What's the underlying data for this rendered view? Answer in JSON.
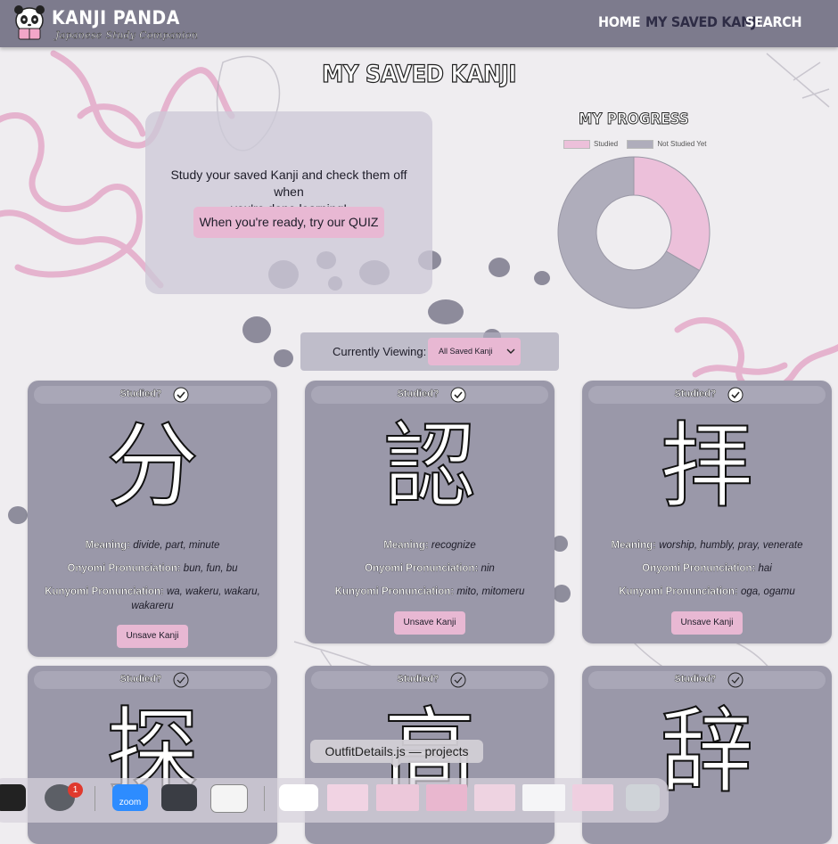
{
  "nav": {
    "brand": "KANJI PANDA",
    "tagline": "Japanese Study Companion",
    "links": [
      {
        "label": "HOME",
        "active": false
      },
      {
        "label": "MY SAVED KANJI",
        "active": true
      },
      {
        "label": "SEARCH",
        "active": false
      }
    ]
  },
  "page": {
    "title": "MY SAVED KANJI",
    "intro_line1": "Study your saved Kanji and check them off when",
    "intro_line2": "you're done learning!",
    "quiz_button": "When you're ready, try our QUIZ"
  },
  "progress": {
    "title": "MY PROGRESS",
    "legend": [
      {
        "label": "Studied",
        "color": "#ecc0da"
      },
      {
        "label": "Not Studied Yet",
        "color": "#afadbb"
      }
    ]
  },
  "chart_data": {
    "type": "pie",
    "title": "MY PROGRESS",
    "labels": [
      "Studied",
      "Not Studied Yet"
    ],
    "values": [
      3,
      6
    ],
    "colors": [
      "#ecc0da",
      "#afadbb"
    ],
    "legend": "top"
  },
  "filter": {
    "label": "Currently Viewing:",
    "selected": "All Saved Kanji"
  },
  "labels": {
    "studied": "Studied?",
    "meaning": "Meaning:",
    "onyomi": "Onyomi Pronunciation:",
    "kunyomi": "Kunyomi Pronunciation:",
    "unsave": "Unsave Kanji"
  },
  "cards": [
    {
      "kanji": "分",
      "studied": true,
      "meaning": "divide, part, minute",
      "onyomi": "bun, fun, bu",
      "kunyomi_1": "wa, wakeru, wakaru,",
      "kunyomi_2": "wakareru"
    },
    {
      "kanji": "認",
      "studied": true,
      "meaning": "recognize",
      "onyomi": "nin",
      "kunyomi_1": "mito, mitomeru",
      "kunyomi_2": ""
    },
    {
      "kanji": "拝",
      "studied": true,
      "meaning": "worship, humbly, pray, venerate",
      "onyomi": "hai",
      "kunyomi_1": "oga, ogamu",
      "kunyomi_2": ""
    },
    {
      "kanji": "探",
      "studied": false
    },
    {
      "kanji": "高",
      "studied": false
    },
    {
      "kanji": "辞",
      "studied": false
    }
  ],
  "dock": {
    "tooltip": "OutfitDetails.js — projects",
    "badge": "1",
    "zoom_label": "zoom",
    "colors": {
      "accent_pink": "#e8b8d3",
      "card_gray": "#9a98a9",
      "nav_gray": "#7d7b8d"
    }
  }
}
